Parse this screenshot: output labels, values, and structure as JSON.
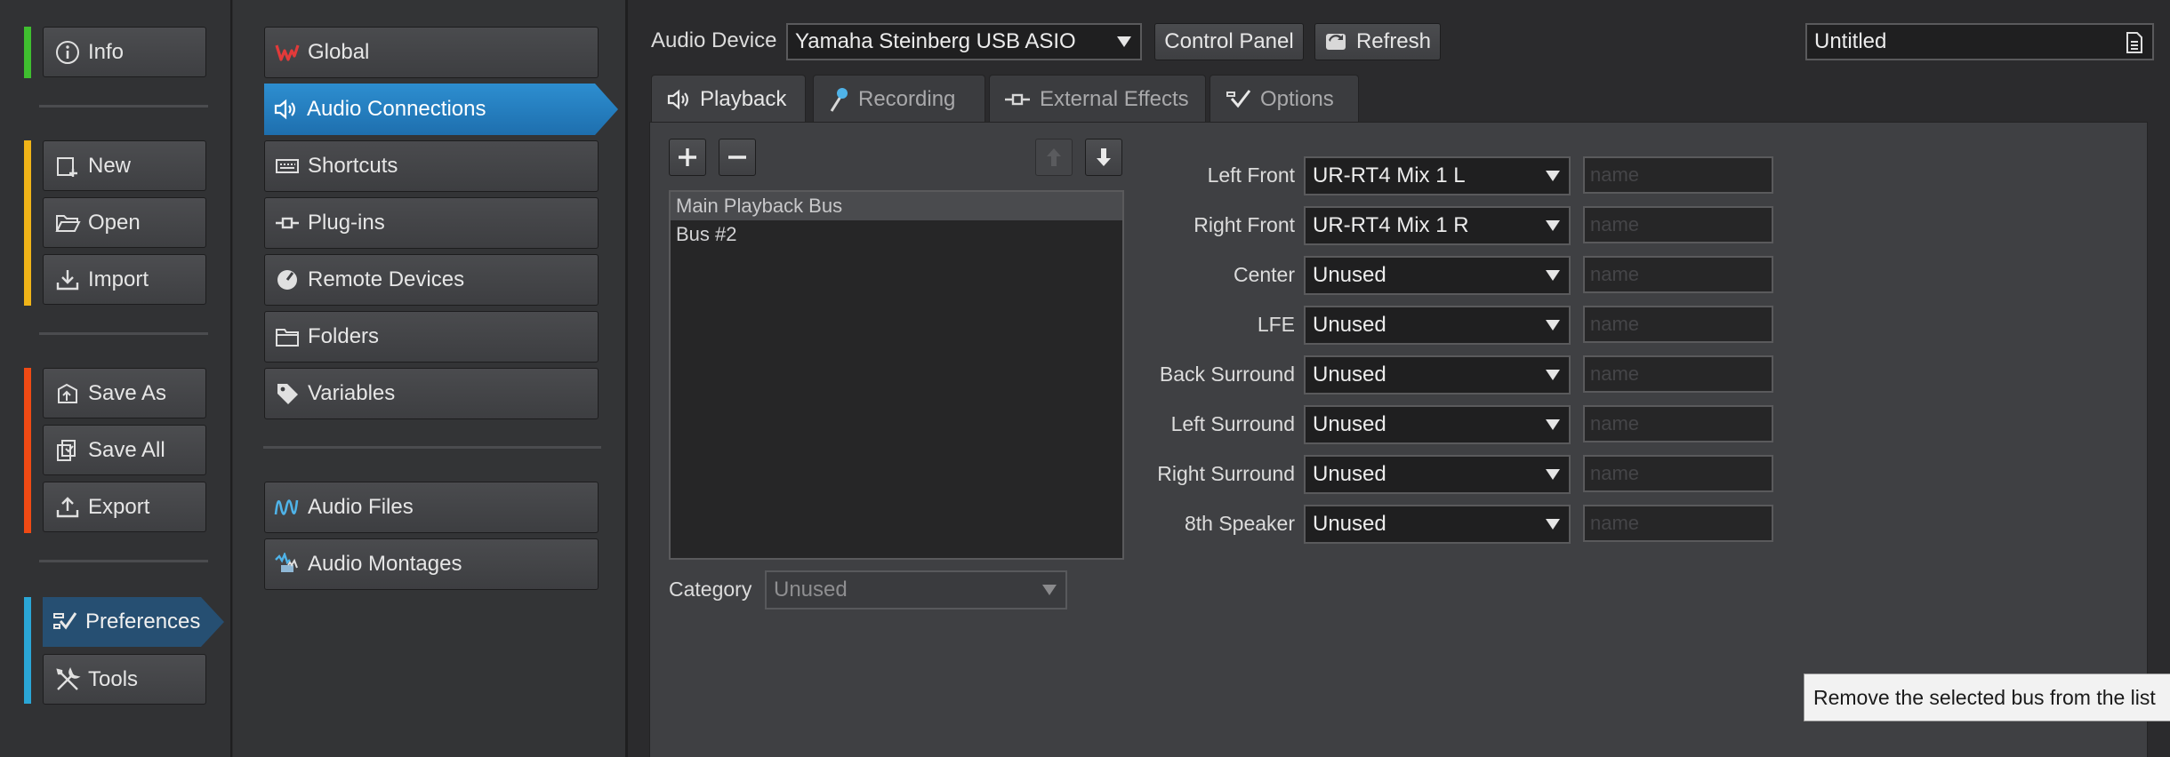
{
  "left_nav": {
    "info": "Info",
    "new": "New",
    "open": "Open",
    "import": "Import",
    "save_as": "Save As",
    "save_all": "Save All",
    "export": "Export",
    "preferences": "Preferences",
    "tools": "Tools",
    "strip_colors": {
      "info": "#3fbf2f",
      "file": "#f0b418",
      "save": "#f04a14",
      "prefs": "#2aa6d6"
    }
  },
  "mid_nav": {
    "items": [
      {
        "label": "Global",
        "icon": "wavelab-logo-icon"
      },
      {
        "label": "Audio Connections",
        "icon": "speaker-icon",
        "active": true
      },
      {
        "label": "Shortcuts",
        "icon": "keyboard-icon"
      },
      {
        "label": "Plug-ins",
        "icon": "plugin-icon"
      },
      {
        "label": "Remote Devices",
        "icon": "knob-icon"
      },
      {
        "label": "Folders",
        "icon": "folder-icon"
      },
      {
        "label": "Variables",
        "icon": "tag-icon"
      }
    ],
    "files": [
      {
        "label": "Audio Files",
        "icon": "waveform-icon"
      },
      {
        "label": "Audio Montages",
        "icon": "montage-icon"
      }
    ]
  },
  "header": {
    "audio_device_label": "Audio Device",
    "audio_device_value": "Yamaha Steinberg USB ASIO",
    "control_panel": "Control Panel",
    "refresh": "Refresh",
    "preset_name": "Untitled"
  },
  "tabs": [
    {
      "label": "Playback",
      "icon": "speaker-icon",
      "active": true
    },
    {
      "label": "Recording",
      "icon": "microphone-icon"
    },
    {
      "label": "External Effects",
      "icon": "plugin-icon"
    },
    {
      "label": "Options",
      "icon": "checkmark-icon"
    }
  ],
  "buses": [
    "Main Playback Bus",
    "Bus #2"
  ],
  "category": {
    "label": "Category",
    "value": "Unused"
  },
  "channels": [
    {
      "label": "Left Front",
      "value": "UR-RT4 Mix 1 L",
      "name_placeholder": "name"
    },
    {
      "label": "Right Front",
      "value": "UR-RT4 Mix 1 R",
      "name_placeholder": "name"
    },
    {
      "label": "Center",
      "value": "Unused",
      "name_placeholder": "name"
    },
    {
      "label": "LFE",
      "value": "Unused",
      "name_placeholder": "name"
    },
    {
      "label": "Back Surround",
      "value": "Unused",
      "name_placeholder": "name"
    },
    {
      "label": "Left Surround",
      "value": "Unused",
      "name_placeholder": "name"
    },
    {
      "label": "Right Surround",
      "value": "Unused",
      "name_placeholder": "name"
    },
    {
      "label": "8th Speaker",
      "value": "Unused",
      "name_placeholder": "name"
    }
  ],
  "tooltip": "Remove the selected bus from the list",
  "colors": {
    "accent_blue": "#2583c6",
    "prefs_active": "#264f72"
  }
}
